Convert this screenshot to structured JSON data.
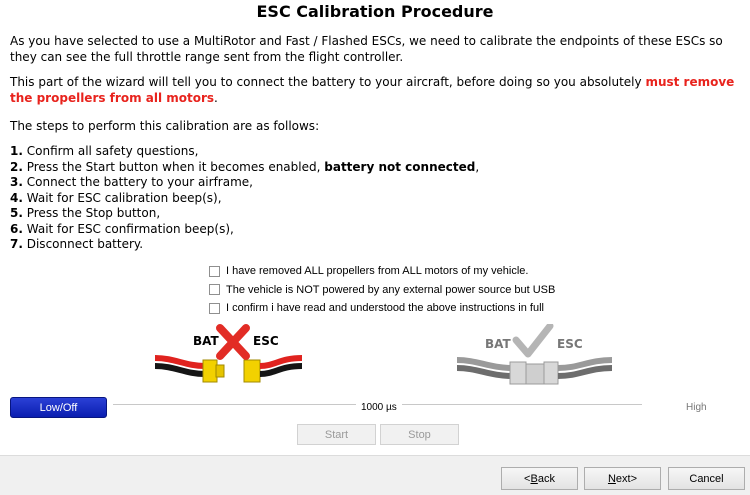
{
  "title": "ESC Calibration Procedure",
  "intro": "As you have selected to use a MultiRotor and Fast / Flashed ESCs, we need to calibrate the endpoints of these ESCs so they can see the full throttle range sent from the flight controller.",
  "warning": {
    "prefix": "This part of the wizard will tell you to connect the battery to your aircraft, before doing so you absolutely ",
    "emphasis": "must remove the propellers from all motors",
    "suffix": "."
  },
  "steps_intro": "The steps to perform this calibration are as follows:",
  "steps": [
    {
      "num": "1.",
      "text": " Confirm all safety questions,"
    },
    {
      "num": "2.",
      "text": " Press the Start button when it becomes enabled, ",
      "bold": "battery not connected",
      "after": ","
    },
    {
      "num": "3.",
      "text": " Connect the battery to your airframe,"
    },
    {
      "num": "4.",
      "text": " Wait for ESC calibration beep(s),"
    },
    {
      "num": "5.",
      "text": " Press the Stop button,"
    },
    {
      "num": "6.",
      "text": " Wait for ESC confirmation beep(s),"
    },
    {
      "num": "7.",
      "text": " Disconnect battery."
    }
  ],
  "checkboxes": [
    {
      "label": "I have removed ALL propellers from ALL motors of my vehicle.",
      "checked": false
    },
    {
      "label": "The vehicle is NOT powered by any external power source but USB",
      "checked": false
    },
    {
      "label": "I confirm i have read and understood the above instructions in full",
      "checked": false
    }
  ],
  "diagram_left": {
    "bat": "BAT",
    "esc": "ESC",
    "icon": "red-x-icon"
  },
  "diagram_right": {
    "bat": "BAT",
    "esc": "ESC",
    "icon": "grey-check-icon"
  },
  "throttle": {
    "low_label": "Low/Off",
    "value_label": "1000 µs",
    "high_label": "High",
    "level": 0
  },
  "controls": {
    "start": "Start",
    "stop": "Stop"
  },
  "wizard": {
    "back": {
      "mnemonic": "B",
      "rest": "ack",
      "prefix": "< "
    },
    "next": {
      "mnemonic": "N",
      "rest": "ext",
      "suffix": " >"
    },
    "cancel": "Cancel"
  },
  "colors": {
    "warning": "#e8231d",
    "accent": "#1128c4"
  }
}
